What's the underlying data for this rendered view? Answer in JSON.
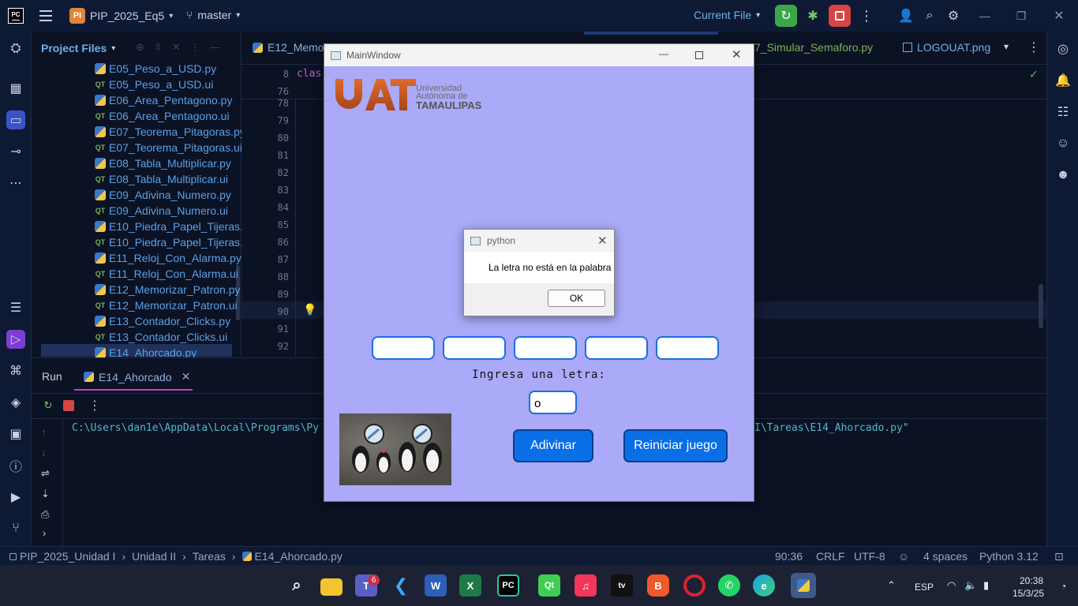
{
  "titlebar": {
    "app_badge": "PC",
    "project_badge": "PI",
    "project_name": "PIP_2025_Eq5",
    "branch": "master",
    "run_config": "Current File"
  },
  "project_panel": {
    "title": "Project Files",
    "files": [
      {
        "name": "E05_Peso_a_USD.py",
        "type": "py"
      },
      {
        "name": "E05_Peso_a_USD.ui",
        "type": "ui"
      },
      {
        "name": "E06_Area_Pentagono.py",
        "type": "py"
      },
      {
        "name": "E06_Area_Pentagono.ui",
        "type": "ui"
      },
      {
        "name": "E07_Teorema_Pitagoras.py",
        "type": "py"
      },
      {
        "name": "E07_Teorema_Pitagoras.ui",
        "type": "ui"
      },
      {
        "name": "E08_Tabla_Multiplicar.py",
        "type": "py"
      },
      {
        "name": "E08_Tabla_Multiplicar.ui",
        "type": "ui"
      },
      {
        "name": "E09_Adivina_Numero.py",
        "type": "py"
      },
      {
        "name": "E09_Adivina_Numero.ui",
        "type": "ui"
      },
      {
        "name": "E10_Piedra_Papel_Tijeras.py",
        "type": "py"
      },
      {
        "name": "E10_Piedra_Papel_Tijeras.ui",
        "type": "ui"
      },
      {
        "name": "E11_Reloj_Con_Alarma.py",
        "type": "py"
      },
      {
        "name": "E11_Reloj_Con_Alarma.ui",
        "type": "ui"
      },
      {
        "name": "E12_Memorizar_Patron.py",
        "type": "py"
      },
      {
        "name": "E12_Memorizar_Patron.ui",
        "type": "ui"
      },
      {
        "name": "E13_Contador_Clicks.py",
        "type": "py"
      },
      {
        "name": "E13_Contador_Clicks.ui",
        "type": "ui"
      },
      {
        "name": "E14_Ahorcado.py",
        "type": "py"
      }
    ]
  },
  "editor": {
    "tabs": [
      {
        "label": "E12_Memor"
      },
      {
        "label": "7_Simular_Semaforo.py"
      },
      {
        "label": "LOGOUAT.png"
      }
    ],
    "sticky_lines": [
      "8",
      "76"
    ],
    "sticky_code": "clas",
    "line_numbers": [
      "78",
      "79",
      "80",
      "81",
      "82",
      "83",
      "84",
      "85",
      "86",
      "87",
      "88",
      "89",
      "90",
      "91",
      "92"
    ]
  },
  "run_panel": {
    "tab_run": "Run",
    "tab_config": "E14_Ahorcado",
    "command_left": "C:\\Users\\dan1e\\AppData\\Local\\Programs\\Py",
    "command_right": "I\\Tareas\\E14_Ahorcado.py\""
  },
  "statusbar": {
    "crumbs": [
      "PIP_2025_Unidad I",
      "Unidad II",
      "Tareas",
      "E14_Ahorcado.py"
    ],
    "position": "90:36",
    "line_ending": "CRLF",
    "encoding": "UTF-8",
    "indent": "4 spaces",
    "interpreter": "Python 3.12"
  },
  "main_window": {
    "title": "MainWindow",
    "logo": {
      "letters": "UAT",
      "line1": "Universidad",
      "line2": "Autónoma de",
      "line3": "TAMAULIPAS"
    },
    "prompt_label": "Ingresa una letra:",
    "letter_input_value": "o",
    "guess_button": "Adivinar",
    "reset_button": "Reiniciar juego"
  },
  "dialog": {
    "title": "python",
    "message": "La letra no está en la palabra",
    "ok_button": "OK"
  },
  "taskbar": {
    "teams_badge": "6",
    "lang": "ESP",
    "time": "20:38",
    "date": "15/3/25"
  },
  "colors": {
    "accent": "#0a6fe6",
    "window_bg": "#aaaaf8",
    "ide_bg": "#0b1224",
    "run_tab_underline": "#c040d0"
  }
}
